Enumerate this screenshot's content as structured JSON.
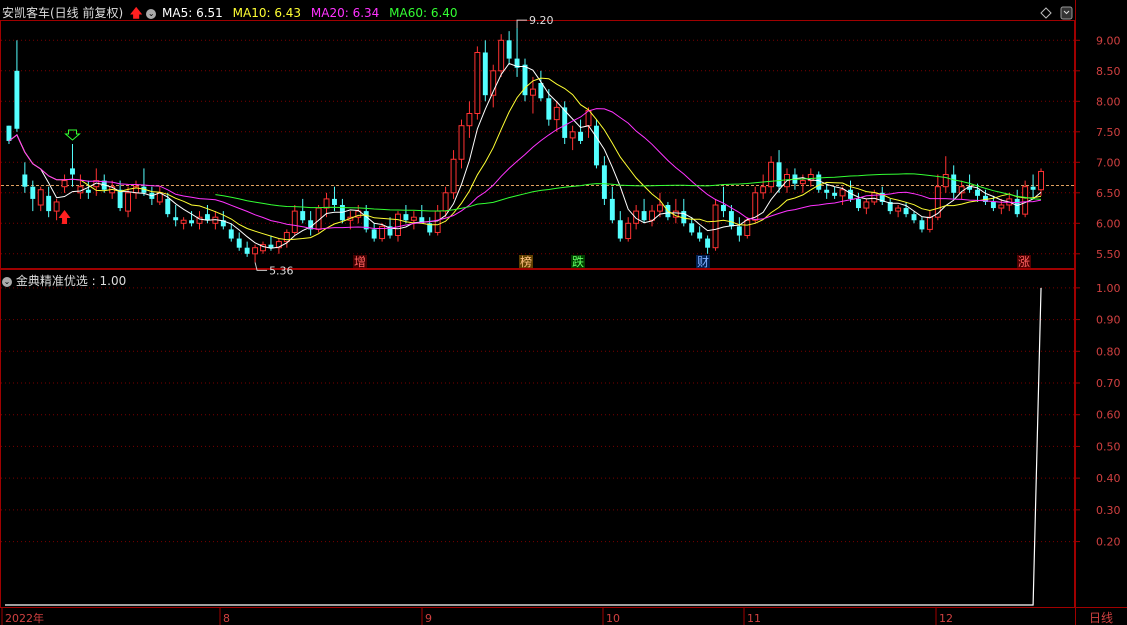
{
  "header": {
    "stock_title": "安凯客车(日线 前复权)",
    "ma5": "MA5: 6.51",
    "ma10": "MA10: 6.43",
    "ma20": "MA20: 6.34",
    "ma60": "MA60: 6.40"
  },
  "indicator": {
    "title": "金典精准优选 : 1.00"
  },
  "chart_data": [
    {
      "type": "candlestick",
      "title": "安凯客车(日线 前复权)",
      "ylim": [
        5.3,
        9.3
      ],
      "y_ticks": [
        "9.00",
        "8.50",
        "8.00",
        "7.50",
        "7.00",
        "6.50",
        "6.00",
        "5.50"
      ],
      "reference_price": 6.62,
      "annotations": {
        "high": "9.20",
        "low": "5.36",
        "markers": [
          "增",
          "榜",
          "跌",
          "财",
          "涨"
        ]
      },
      "colors": {
        "up": "#ff3232",
        "down": "#54ffff",
        "ma5": "#ffffff",
        "ma10": "#ffff33",
        "ma20": "#ff33ff",
        "ma60": "#33ff33"
      },
      "ohlc": [
        [
          7.6,
          7.6,
          7.3,
          7.35
        ],
        [
          8.5,
          9.0,
          7.5,
          7.55
        ],
        [
          6.8,
          7.0,
          6.5,
          6.6
        ],
        [
          6.6,
          6.7,
          6.2,
          6.4
        ],
        [
          6.3,
          6.6,
          6.2,
          6.55
        ],
        [
          6.45,
          6.6,
          6.1,
          6.2
        ],
        [
          6.2,
          6.4,
          6.05,
          6.35
        ],
        [
          6.6,
          6.8,
          6.5,
          6.7
        ],
        [
          6.9,
          7.3,
          6.6,
          6.8
        ],
        [
          6.5,
          6.8,
          6.4,
          6.6
        ],
        [
          6.55,
          6.7,
          6.4,
          6.5
        ],
        [
          6.6,
          6.9,
          6.45,
          6.7
        ],
        [
          6.7,
          6.8,
          6.5,
          6.55
        ],
        [
          6.5,
          6.7,
          6.4,
          6.6
        ],
        [
          6.55,
          6.7,
          6.2,
          6.25
        ],
        [
          6.2,
          6.6,
          6.1,
          6.5
        ],
        [
          6.5,
          6.7,
          6.4,
          6.6
        ],
        [
          6.6,
          6.9,
          6.45,
          6.5
        ],
        [
          6.5,
          6.6,
          6.3,
          6.4
        ],
        [
          6.35,
          6.6,
          6.3,
          6.5
        ],
        [
          6.4,
          6.5,
          6.1,
          6.15
        ],
        [
          6.1,
          6.3,
          5.95,
          6.05
        ],
        [
          6.0,
          6.1,
          5.9,
          6.05
        ],
        [
          6.05,
          6.2,
          5.95,
          6.0
        ],
        [
          6.0,
          6.2,
          5.9,
          6.1
        ],
        [
          6.15,
          6.3,
          6.0,
          6.05
        ],
        [
          6.0,
          6.2,
          5.9,
          6.1
        ],
        [
          6.05,
          6.2,
          5.9,
          5.95
        ],
        [
          5.9,
          6.0,
          5.7,
          5.75
        ],
        [
          5.75,
          5.85,
          5.55,
          5.6
        ],
        [
          5.6,
          5.7,
          5.45,
          5.5
        ],
        [
          5.5,
          5.65,
          5.36,
          5.6
        ],
        [
          5.55,
          5.7,
          5.5,
          5.65
        ],
        [
          5.65,
          5.8,
          5.55,
          5.6
        ],
        [
          5.6,
          5.75,
          5.5,
          5.7
        ],
        [
          5.7,
          5.9,
          5.6,
          5.85
        ],
        [
          5.85,
          6.3,
          5.8,
          6.2
        ],
        [
          6.2,
          6.4,
          6.0,
          6.05
        ],
        [
          6.05,
          6.2,
          5.8,
          5.9
        ],
        [
          5.9,
          6.3,
          5.85,
          6.25
        ],
        [
          6.25,
          6.5,
          6.1,
          6.4
        ],
        [
          6.4,
          6.6,
          6.2,
          6.3
        ],
        [
          6.3,
          6.4,
          6.0,
          6.05
        ],
        [
          6.05,
          6.2,
          5.9,
          6.1
        ],
        [
          6.1,
          6.3,
          6.0,
          6.2
        ],
        [
          6.2,
          6.3,
          5.85,
          5.9
        ],
        [
          5.9,
          6.0,
          5.7,
          5.75
        ],
        [
          5.75,
          6.0,
          5.7,
          5.95
        ],
        [
          5.95,
          6.1,
          5.75,
          5.8
        ],
        [
          5.8,
          6.2,
          5.7,
          6.15
        ],
        [
          6.15,
          6.3,
          6.0,
          6.05
        ],
        [
          6.05,
          6.2,
          5.9,
          6.1
        ],
        [
          6.1,
          6.3,
          6.0,
          6.0
        ],
        [
          6.0,
          6.1,
          5.8,
          5.85
        ],
        [
          5.85,
          6.3,
          5.8,
          6.2
        ],
        [
          6.2,
          6.6,
          6.1,
          6.5
        ],
        [
          6.5,
          7.2,
          6.4,
          7.05
        ],
        [
          7.05,
          7.7,
          6.9,
          7.6
        ],
        [
          7.6,
          8.0,
          7.4,
          7.8
        ],
        [
          7.8,
          8.9,
          7.7,
          8.8
        ],
        [
          8.8,
          9.0,
          8.0,
          8.1
        ],
        [
          8.1,
          8.6,
          7.9,
          8.5
        ],
        [
          8.5,
          9.1,
          8.4,
          9.0
        ],
        [
          9.0,
          9.15,
          8.6,
          8.7
        ],
        [
          8.7,
          9.2,
          8.4,
          8.55
        ],
        [
          8.6,
          8.7,
          8.0,
          8.1
        ],
        [
          8.1,
          8.4,
          7.8,
          8.2
        ],
        [
          8.3,
          8.5,
          8.0,
          8.05
        ],
        [
          8.05,
          8.2,
          7.6,
          7.7
        ],
        [
          7.7,
          8.0,
          7.5,
          7.9
        ],
        [
          7.9,
          8.0,
          7.3,
          7.4
        ],
        [
          7.4,
          7.6,
          7.2,
          7.5
        ],
        [
          7.5,
          7.7,
          7.3,
          7.35
        ],
        [
          7.6,
          7.9,
          7.4,
          7.85
        ],
        [
          7.6,
          7.7,
          6.9,
          6.95
        ],
        [
          6.95,
          7.1,
          6.3,
          6.4
        ],
        [
          6.4,
          6.6,
          6.0,
          6.05
        ],
        [
          6.05,
          6.2,
          5.7,
          5.75
        ],
        [
          5.75,
          6.1,
          5.7,
          6.0
        ],
        [
          6.0,
          6.3,
          5.9,
          6.2
        ],
        [
          6.2,
          6.4,
          6.0,
          6.05
        ],
        [
          6.05,
          6.3,
          5.95,
          6.2
        ],
        [
          6.2,
          6.5,
          6.1,
          6.3
        ],
        [
          6.3,
          6.35,
          6.05,
          6.1
        ],
        [
          6.1,
          6.4,
          6.0,
          6.2
        ],
        [
          6.2,
          6.4,
          5.95,
          6.0
        ],
        [
          6.0,
          6.1,
          5.8,
          5.85
        ],
        [
          5.85,
          5.95,
          5.7,
          5.75
        ],
        [
          5.75,
          5.8,
          5.5,
          5.6
        ],
        [
          5.6,
          6.4,
          5.55,
          6.3
        ],
        [
          6.3,
          6.6,
          6.1,
          6.2
        ],
        [
          6.2,
          6.3,
          5.9,
          5.95
        ],
        [
          5.95,
          6.1,
          5.7,
          5.8
        ],
        [
          5.8,
          6.1,
          5.75,
          6.05
        ],
        [
          6.05,
          6.6,
          6.0,
          6.5
        ],
        [
          6.5,
          6.8,
          6.4,
          6.6
        ],
        [
          6.6,
          7.1,
          6.5,
          7.0
        ],
        [
          7.0,
          7.2,
          6.5,
          6.6
        ],
        [
          6.6,
          6.9,
          6.5,
          6.8
        ],
        [
          6.8,
          6.9,
          6.55,
          6.65
        ],
        [
          6.65,
          6.8,
          6.5,
          6.7
        ],
        [
          6.7,
          6.9,
          6.6,
          6.8
        ],
        [
          6.8,
          6.85,
          6.5,
          6.55
        ],
        [
          6.55,
          6.65,
          6.4,
          6.5
        ],
        [
          6.5,
          6.6,
          6.4,
          6.45
        ],
        [
          6.45,
          6.6,
          6.3,
          6.55
        ],
        [
          6.55,
          6.7,
          6.35,
          6.4
        ],
        [
          6.4,
          6.5,
          6.2,
          6.25
        ],
        [
          6.25,
          6.4,
          6.15,
          6.35
        ],
        [
          6.35,
          6.55,
          6.3,
          6.5
        ],
        [
          6.5,
          6.6,
          6.3,
          6.35
        ],
        [
          6.35,
          6.4,
          6.15,
          6.2
        ],
        [
          6.2,
          6.3,
          6.1,
          6.25
        ],
        [
          6.25,
          6.35,
          6.1,
          6.15
        ],
        [
          6.15,
          6.2,
          6.0,
          6.05
        ],
        [
          6.05,
          6.1,
          5.85,
          5.9
        ],
        [
          5.9,
          6.2,
          5.85,
          6.1
        ],
        [
          6.1,
          6.8,
          6.05,
          6.6
        ],
        [
          6.6,
          7.1,
          6.5,
          6.8
        ],
        [
          6.8,
          6.95,
          6.4,
          6.5
        ],
        [
          6.5,
          6.7,
          6.4,
          6.6
        ],
        [
          6.6,
          6.8,
          6.5,
          6.55
        ],
        [
          6.55,
          6.65,
          6.35,
          6.45
        ],
        [
          6.45,
          6.55,
          6.3,
          6.35
        ],
        [
          6.35,
          6.45,
          6.2,
          6.25
        ],
        [
          6.25,
          6.4,
          6.15,
          6.3
        ],
        [
          6.3,
          6.5,
          6.2,
          6.4
        ],
        [
          6.4,
          6.55,
          6.1,
          6.15
        ],
        [
          6.15,
          6.7,
          6.1,
          6.6
        ],
        [
          6.6,
          6.8,
          6.4,
          6.55
        ],
        [
          6.55,
          6.9,
          6.45,
          6.85
        ]
      ]
    },
    {
      "type": "line",
      "title": "金典精准优选",
      "ylim": [
        0,
        1.05
      ],
      "y_ticks": [
        "1.00",
        "0.90",
        "0.80",
        "0.70",
        "0.60",
        "0.50",
        "0.40",
        "0.30",
        "0.20"
      ],
      "value_before_jump": 0.0,
      "final_value": 1.0
    }
  ],
  "x_axis": {
    "labels": [
      "2022年",
      "8",
      "9",
      "10",
      "11",
      "12"
    ],
    "period_label": "日线"
  }
}
